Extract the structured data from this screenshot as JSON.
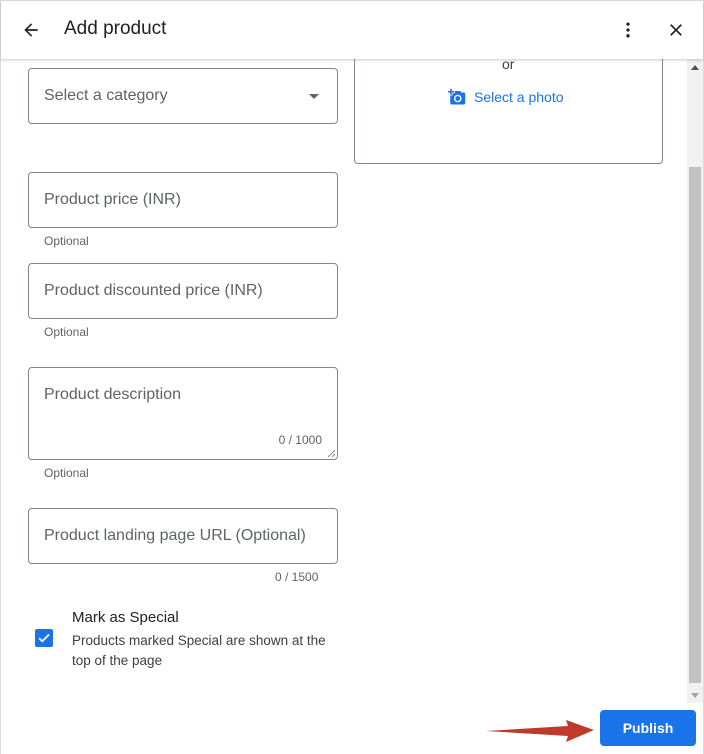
{
  "header": {
    "title": "Add product",
    "back_icon": "arrow-left-icon",
    "more_icon": "more-vertical-icon",
    "close_icon": "close-icon"
  },
  "photo": {
    "or_text": "or",
    "select_label": "Select a photo",
    "icon": "add-photo-icon"
  },
  "form": {
    "category_placeholder": "Select a category",
    "price_placeholder": "Product price (INR)",
    "price_helper": "Optional",
    "discounted_placeholder": "Product discounted price (INR)",
    "discounted_helper": "Optional",
    "description_placeholder": "Product description",
    "description_counter": "0 / 1000",
    "description_helper": "Optional",
    "url_placeholder": "Product landing page URL (Optional)",
    "url_counter": "0 / 1500"
  },
  "special": {
    "title": "Mark as Special",
    "description": "Products marked Special are shown at the top of the page",
    "checked": true
  },
  "footer": {
    "publish_label": "Publish"
  },
  "colors": {
    "accent": "#1a73e8",
    "annotation_arrow": "#c0392b"
  }
}
